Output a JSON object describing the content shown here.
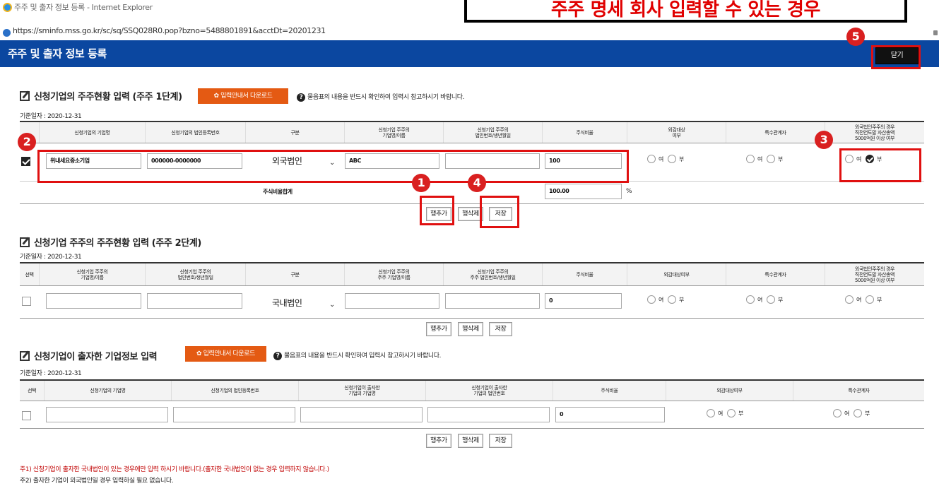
{
  "window": {
    "title": "주주 및 출자 정보 등록 - Internet Explorer",
    "url": "https://sminfo.mss.go.kr/sc/sq/SSQ028R0.pop?bzno=5488801891&acctDt=20201231"
  },
  "callout": "주주 명세 회사 입력할 수 있는 경우",
  "header": {
    "title": "주주 및 출자 정보 등록",
    "close_label": "닫기"
  },
  "section1": {
    "title": "신청기업의 주주현황 입력 (주주 1단계)",
    "download_label": "입력안내서 다운로드",
    "note": "물음표의 내용을 반드시 확인하여 입력시 참고하시기 바랍니다.",
    "base_date": "기준일자 : 2020-12-31",
    "columns": [
      "신청기업의 기업명",
      "신청기업의 법인등록번호",
      "구분",
      "신청기업 주주의\n기업명/이름",
      "신청기업 주주의\n법인번호/생년월일",
      "주식비율",
      "외감대상\n여부",
      "특수관계자",
      "외국법인주주의 경우\n직전연도말 자산총액\n5000억원 이상 여부"
    ],
    "row": {
      "company_name": "위내세요중소기업",
      "corp_reg_no": "000000-0000000",
      "type": "외국법인",
      "shareholder_name": "ABC",
      "shareholder_no": "",
      "ratio": "100"
    },
    "total_label": "주식비율합계",
    "total_value": "100.00",
    "total_unit": "%"
  },
  "section2": {
    "title": "신청기업 주주의 주주현황 입력 (주주 2단계)",
    "base_date": "기준일자 : 2020-12-31",
    "columns": [
      "선택",
      "신청기업 주주의\n기업명/이름",
      "신청기업 주주의\n법인번호/생년월일",
      "구분",
      "신청기업 주주의\n주주 기업명/이름",
      "신청기업 주주의\n주주 법인번호/생년월일",
      "주식비율",
      "외감대상여부",
      "특수관계자",
      "외국법인주주의 경우\n직전연도말 자산총액\n5000억원 이상 여부"
    ],
    "row": {
      "type": "국내법인",
      "ratio": "0"
    }
  },
  "section3": {
    "title": "신청기업이 출자한 기업정보 입력",
    "download_label": "입력안내서 다운로드",
    "note": "물음표의 내용을 반드시 확인하여 입력시 참고하시기 바랍니다.",
    "base_date": "기준일자 : 2020-12-31",
    "columns": [
      "선택",
      "신청기업의 기업명",
      "신청기업의 법인등록번호",
      "신청기업이 출자한\n기업의 기업명",
      "신청기업이 출자한\n기업의 법인번호",
      "주식비율",
      "외감대상여부",
      "특수관계자"
    ],
    "row": {
      "ratio": "0"
    }
  },
  "buttons": {
    "add_row": "행추가",
    "delete_row": "행삭제",
    "save": "저장"
  },
  "radio": {
    "yes": "여",
    "no": "부"
  },
  "footnotes": {
    "note1": "주1) 신청기업이 출자한 국내법인이 있는 경우에만 입력 하시기 바랍니다.(출자한 국내법인이 없는 경우 입력하지 않습니다.)",
    "note2": "주2) 출자한 기업이 외국법인일 경우 입력하실 필요 없습니다."
  },
  "badges": [
    "1",
    "2",
    "3",
    "4",
    "5"
  ],
  "colors": {
    "header_bg": "#0b47a0",
    "accent_orange": "#e45a13",
    "highlight_red": "#e01010",
    "footnote_red": "#c00000"
  }
}
